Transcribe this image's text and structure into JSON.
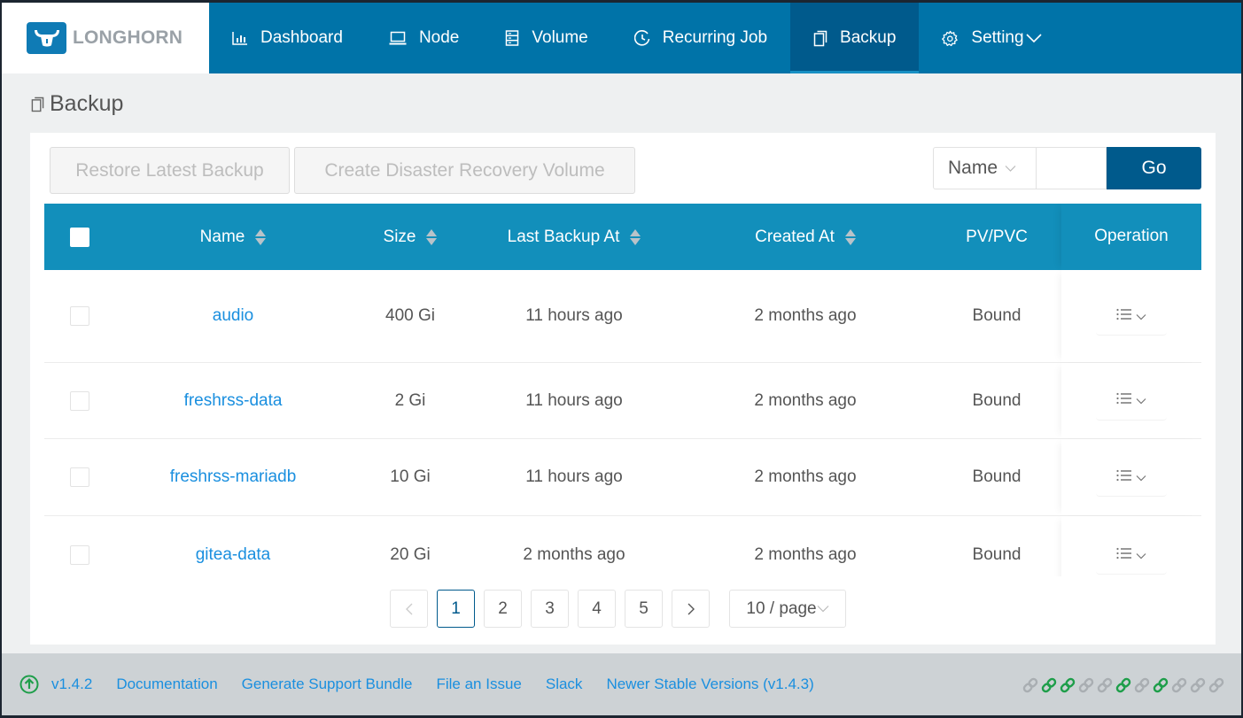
{
  "brand": {
    "name": "LONGHORN"
  },
  "nav": [
    {
      "label": "Dashboard",
      "icon": "bar-chart-icon",
      "active": false
    },
    {
      "label": "Node",
      "icon": "laptop-icon",
      "active": false
    },
    {
      "label": "Volume",
      "icon": "database-icon",
      "active": false
    },
    {
      "label": "Recurring Job",
      "icon": "clock-icon",
      "active": false
    },
    {
      "label": "Backup",
      "icon": "copy-icon",
      "active": true
    },
    {
      "label": "Setting",
      "icon": "gear-icon",
      "active": false,
      "has_dropdown": true
    }
  ],
  "page": {
    "title": "Backup"
  },
  "toolbar": {
    "restore_label": "Restore Latest Backup",
    "dr_label": "Create Disaster Recovery Volume"
  },
  "search": {
    "field_selected": "Name",
    "value": "",
    "go_label": "Go"
  },
  "table": {
    "columns": [
      "Name",
      "Size",
      "Last Backup At",
      "Created At",
      "PV/PVC",
      "Operation"
    ],
    "rows": [
      {
        "name": "audio",
        "size": "400 Gi",
        "last_backup": "11 hours ago",
        "created": "2 months ago",
        "pvpvc": "Bound"
      },
      {
        "name": "freshrss-data",
        "size": "2 Gi",
        "last_backup": "11 hours ago",
        "created": "2 months ago",
        "pvpvc": "Bound"
      },
      {
        "name": "freshrss-mariadb",
        "size": "10 Gi",
        "last_backup": "11 hours ago",
        "created": "2 months ago",
        "pvpvc": "Bound"
      },
      {
        "name": "gitea-data",
        "size": "20 Gi",
        "last_backup": "2 months ago",
        "created": "2 months ago",
        "pvpvc": "Bound"
      }
    ]
  },
  "pagination": {
    "prev": "<",
    "next": ">",
    "pages": [
      "1",
      "2",
      "3",
      "4",
      "5"
    ],
    "current": "1",
    "page_size": "10 / page"
  },
  "footer": {
    "version": "v1.4.2",
    "links": [
      "Documentation",
      "Generate Support Bundle",
      "File an Issue",
      "Slack",
      "Newer Stable Versions (v1.4.3)"
    ],
    "connection_status": [
      "off",
      "on",
      "on",
      "off",
      "off",
      "on",
      "off",
      "on",
      "off",
      "off",
      "off"
    ],
    "colors": {
      "on": "#1e9e4a",
      "off": "#a9aeb2"
    }
  }
}
